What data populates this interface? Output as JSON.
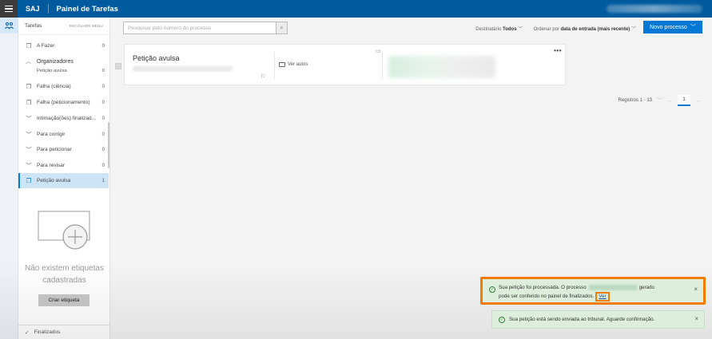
{
  "header": {
    "brand": "SAJ",
    "title": "Painel de Tarefas"
  },
  "rail": {
    "icon": "tasks-icon"
  },
  "sidebar": {
    "header_label": "Tarefas",
    "header_action": "RECOLHER MENU",
    "items": [
      {
        "label": "A Fazer",
        "count": "0",
        "icon": "page-icon"
      },
      {
        "label": "Falha (ciência)",
        "count": "0",
        "icon": "page-icon"
      },
      {
        "label": "Falha (peticionamento)",
        "count": "0",
        "icon": "page-icon"
      },
      {
        "label": "Intimação(ões) finalizad...",
        "count": "0",
        "icon": "chevron-down-icon"
      },
      {
        "label": "Para corrigir",
        "count": "0",
        "icon": "chevron-down-icon"
      },
      {
        "label": "Para peticionar",
        "count": "0",
        "icon": "chevron-down-icon"
      },
      {
        "label": "Para revisar",
        "count": "0",
        "icon": "chevron-down-icon"
      },
      {
        "label": "Petição avulsa",
        "count": "1",
        "icon": "page-icon"
      }
    ],
    "group": {
      "label": "Organizadores",
      "sub_label": "Petição avulsa",
      "sub_count": "0"
    },
    "empty_text_1": "Não existem etiquetas",
    "empty_text_2": "cadastradas",
    "create_tag_label": "Criar etiqueta",
    "footer_label": "Finalizados"
  },
  "toolbar": {
    "search_placeholder": "Pesquisar pelo número do processo",
    "dest_label": "Destinatário",
    "dest_value": "Todos",
    "order_label": "Ordenar por",
    "order_value": "data de entrada (mais recente)",
    "new_process_label": "Novo processo"
  },
  "card": {
    "title": "Petição avulsa",
    "view_files_label": "Ver autos"
  },
  "pager": {
    "records_label": "Registros 1 - 13",
    "current_page": "1"
  },
  "toasts": {
    "first_part1": "Sua petição foi processada. O processo",
    "first_part2": "gerado",
    "first_part3": "pode ser conferido no painel de finalizados.",
    "first_link": "Ver",
    "second": "Sua petição está sendo enviada ao tribunal. Aguarde confirmação.",
    "close_glyph": "×"
  },
  "colors": {
    "topbar": "#005a9e",
    "primary": "#0078d4",
    "highlight": "#f07d00",
    "toast_bg": "#ddeedd"
  }
}
